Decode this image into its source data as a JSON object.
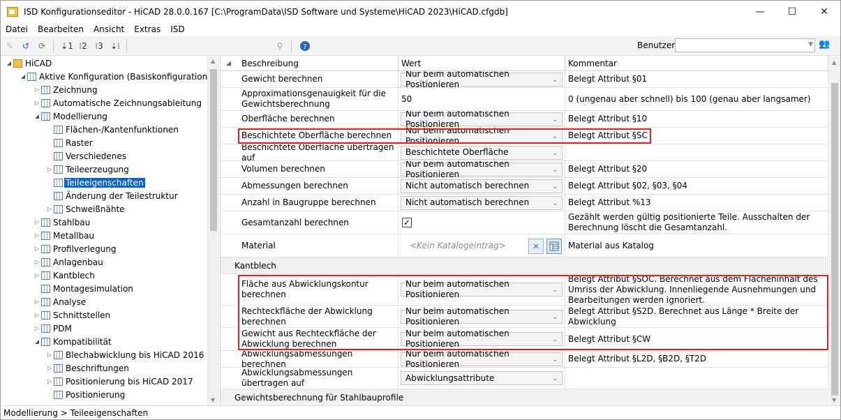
{
  "window": {
    "title": "ISD Konfigurationseditor - HiCAD 28.0.0.167 [C:\\ProgramData\\ISD Software und Systeme\\HiCAD 2023\\HiCAD.cfgdb]",
    "minimize": "—",
    "maximize": "☐",
    "close": "✕"
  },
  "menu": [
    "Datei",
    "Bearbeiten",
    "Ansicht",
    "Extras",
    "ISD"
  ],
  "toolbar": {
    "user_label": "Benutzer",
    "user_value": ""
  },
  "tree": [
    {
      "label": "HiCAD",
      "level": 0,
      "expander": "◢",
      "icon": "root"
    },
    {
      "label": "Aktive Konfiguration (Basiskonfiguration)",
      "level": 1,
      "expander": "◢",
      "icon": "grid"
    },
    {
      "label": "Zeichnung",
      "level": 2,
      "expander": "▷",
      "icon": "grid"
    },
    {
      "label": "Automatische Zeichnungsableitung",
      "level": 2,
      "expander": "▷",
      "icon": "grid"
    },
    {
      "label": "Modellierung",
      "level": 2,
      "expander": "◢",
      "icon": "grid"
    },
    {
      "label": "Flächen-/Kantenfunktionen",
      "level": 3,
      "expander": "",
      "icon": "grid"
    },
    {
      "label": "Raster",
      "level": 3,
      "expander": "",
      "icon": "grid"
    },
    {
      "label": "Verschiedenes",
      "level": 3,
      "expander": "",
      "icon": "grid"
    },
    {
      "label": "Teileerzeugung",
      "level": 3,
      "expander": "▷",
      "icon": "grid"
    },
    {
      "label": "Teileeigenschaften",
      "level": 3,
      "expander": "",
      "icon": "grid",
      "selected": true
    },
    {
      "label": "Änderung der Teilestruktur",
      "level": 3,
      "expander": "",
      "icon": "grid"
    },
    {
      "label": "Schweißnähte",
      "level": 3,
      "expander": "▷",
      "icon": "grid"
    },
    {
      "label": "Stahlbau",
      "level": 2,
      "expander": "▷",
      "icon": "grid"
    },
    {
      "label": "Metallbau",
      "level": 2,
      "expander": "▷",
      "icon": "grid"
    },
    {
      "label": "Profilverlegung",
      "level": 2,
      "expander": "▷",
      "icon": "grid"
    },
    {
      "label": "Anlagenbau",
      "level": 2,
      "expander": "▷",
      "icon": "grid"
    },
    {
      "label": "Kantblech",
      "level": 2,
      "expander": "▷",
      "icon": "grid"
    },
    {
      "label": "Montagesimulation",
      "level": 2,
      "expander": "",
      "icon": "grid"
    },
    {
      "label": "Analyse",
      "level": 2,
      "expander": "▷",
      "icon": "grid"
    },
    {
      "label": "Schnittstellen",
      "level": 2,
      "expander": "▷",
      "icon": "grid"
    },
    {
      "label": "PDM",
      "level": 2,
      "expander": "▷",
      "icon": "grid"
    },
    {
      "label": "Kompatibilität",
      "level": 2,
      "expander": "◢",
      "icon": "grid"
    },
    {
      "label": "Blechabwicklung bis HiCAD 2016",
      "level": 3,
      "expander": "▷",
      "icon": "grid"
    },
    {
      "label": "Beschriftungen",
      "level": 3,
      "expander": "▷",
      "icon": "grid"
    },
    {
      "label": "Positionierung bis HiCAD 2017",
      "level": 3,
      "expander": "▷",
      "icon": "grid"
    },
    {
      "label": "Positionierung",
      "level": 3,
      "expander": "",
      "icon": "grid"
    }
  ],
  "grid": {
    "headers": [
      "Beschreibung",
      "Wert",
      "Kommentar"
    ],
    "rows": [
      {
        "desc": "Gewicht berechnen",
        "type": "dropdown",
        "value": "Nur beim automatischen Positionieren",
        "comment": "Belegt Attribut §01"
      },
      {
        "desc": "Approximationsgenauigkeit für die Gewichtsberechnung",
        "type": "text",
        "value": "50",
        "comment": "0 (ungenau aber schnell) bis 100 (genau aber langsamer)"
      },
      {
        "desc": "Oberfläche berechnen",
        "type": "dropdown",
        "value": "Nur beim automatischen Positionieren",
        "comment": "Belegt Attribut §10"
      },
      {
        "desc": "Beschichtete Oberfläche berechnen",
        "type": "dropdown",
        "value": "Nur beim automatischen Positionieren",
        "comment": "Belegt Attribut §SC"
      },
      {
        "desc": "Beschichtete Oberfläche übertragen auf",
        "type": "dropdown",
        "value": "Beschichtete Oberfläche",
        "comment": ""
      },
      {
        "desc": "Volumen berechnen",
        "type": "dropdown",
        "value": "Nur beim automatischen Positionieren",
        "comment": "Belegt Attribut §20"
      },
      {
        "desc": "Abmessungen berechnen",
        "type": "dropdown",
        "value": "Nicht automatisch berechnen",
        "comment": "Belegt Attribut §02, §03, §04"
      },
      {
        "desc": "Anzahl in Baugruppe berechnen",
        "type": "dropdown",
        "value": "Nicht automatisch berechnen",
        "comment": "Belegt Attribut %13"
      },
      {
        "desc": "Gesamtanzahl berechnen",
        "type": "checkbox",
        "value": "✓",
        "comment": "Gezählt werden gültig positionierte Teile. Ausschalten der Berechnung löscht die Gesamtanzahl."
      },
      {
        "desc": "Material",
        "type": "catalog",
        "value": "<Kein Katalogeintrag>",
        "comment": "Material aus Katalog"
      }
    ],
    "section_kantblech": "Kantblech",
    "kantblech_rows": [
      {
        "desc": "Fläche aus Abwicklungskontur berechnen",
        "type": "dropdown",
        "value": "Nur beim automatischen Positionieren",
        "comment": "Belegt Attribut §SOC. Berechnet aus dem Flächeninhalt des Umriss der Abwicklung. Innenliegende Ausnehmungen und Bearbeitungen werden ignoriert."
      },
      {
        "desc": "Rechteckfläche der Abwicklung berechnen",
        "type": "dropdown",
        "value": "Nur beim automatischen Positionieren",
        "comment": "Belegt Attribut §S2D. Berechnet aus Länge * Breite der Abwicklung"
      },
      {
        "desc": "Gewicht aus Rechteckfläche der Abwicklung berechnen",
        "type": "dropdown",
        "value": "Nur beim automatischen Positionieren",
        "comment": "Belegt Attribut §CW"
      },
      {
        "desc": "Abwicklungsabmessungen berechnen",
        "type": "dropdown",
        "value": "Nur beim automatischen Positionieren",
        "comment": "Belegt Attribut §L2D, §B2D, §T2D"
      },
      {
        "desc": "Abwicklungsabmessungen übertragen auf",
        "type": "dropdown",
        "value": "Abwicklungsattribute",
        "comment": ""
      }
    ],
    "section_stahlbau": "Gewichtsberechnung für Stahlbauprofile"
  },
  "status": "Modellierung > Teileeigenschaften",
  "colors": {
    "selection": "#0a64c8",
    "highlight_box": "#e01e1e"
  }
}
